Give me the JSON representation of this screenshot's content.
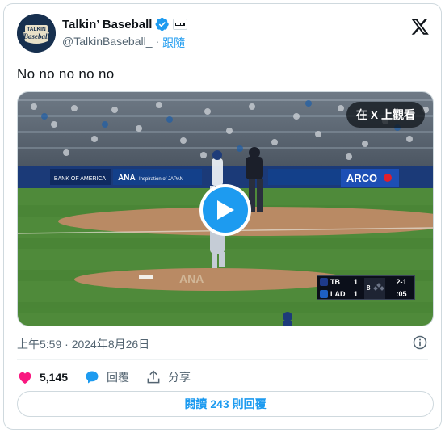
{
  "author": {
    "display_name": "Talkin’ Baseball",
    "handle": "@TalkinBaseball_",
    "separator": "·",
    "follow_label": "跟隨",
    "avatar_text_top": "TALKIN",
    "avatar_text_main": "Baseball",
    "verified": true
  },
  "tweet": {
    "text": "No no no no no"
  },
  "media": {
    "watch_on_x_label": "在 X 上觀看",
    "field_signs": {
      "bank": "BANK OF AMERICA",
      "ana": "ANA",
      "ana_sub": "Inspiration of JAPAN",
      "arco": "ARCO"
    },
    "scorebug": {
      "away_team": "TB",
      "away_score": "1",
      "home_team": "LAD",
      "home_score": "1",
      "inning": "8",
      "count": "2-1",
      "pitch_clock": ":05"
    }
  },
  "meta": {
    "timestamp": "上午5:59 · 2024年8月26日"
  },
  "actions": {
    "likes_count": "5,145",
    "reply_label": "回覆",
    "share_label": "分享"
  },
  "read_replies": {
    "prefix": "閱讀",
    "count": "243",
    "suffix": "則回覆"
  },
  "colors": {
    "accent": "#1d9bf0",
    "like": "#f91880",
    "muted": "#536471",
    "text": "#0f1419"
  }
}
